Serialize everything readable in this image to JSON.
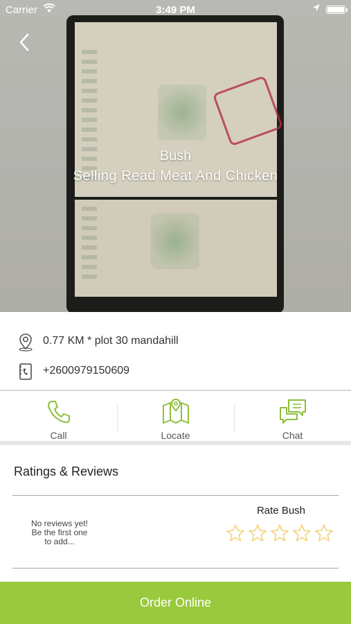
{
  "status_bar": {
    "carrier": "Carrier",
    "time": "3:49 PM",
    "icons": [
      "wifi-icon",
      "location-arrow-icon",
      "battery-icon"
    ]
  },
  "hero": {
    "title": "Bush",
    "subtitle": "Selling Read Meat And Chicken",
    "back_icon": "back-chevron-icon"
  },
  "info": {
    "address": "0.77 KM * plot 30 mandahill",
    "phone": "+2600979150609",
    "address_icon": "location-pin-icon",
    "phone_icon": "phone-book-icon"
  },
  "actions": [
    {
      "label": "Call",
      "icon": "phone-icon"
    },
    {
      "label": "Locate",
      "icon": "map-icon"
    },
    {
      "label": "Chat",
      "icon": "chat-icon"
    }
  ],
  "ratings": {
    "title": "Ratings & Reviews",
    "empty_line1": "No reviews yet!",
    "empty_line2": "Be the first one",
    "empty_line3": "to add...",
    "rate_label": "Rate Bush",
    "rating": 0,
    "max_rating": 5
  },
  "order_button": {
    "label": "Order Online"
  },
  "colors": {
    "accent": "#9ac93d",
    "icon_green": "#8cbf3a",
    "star": "#f2d27a"
  }
}
